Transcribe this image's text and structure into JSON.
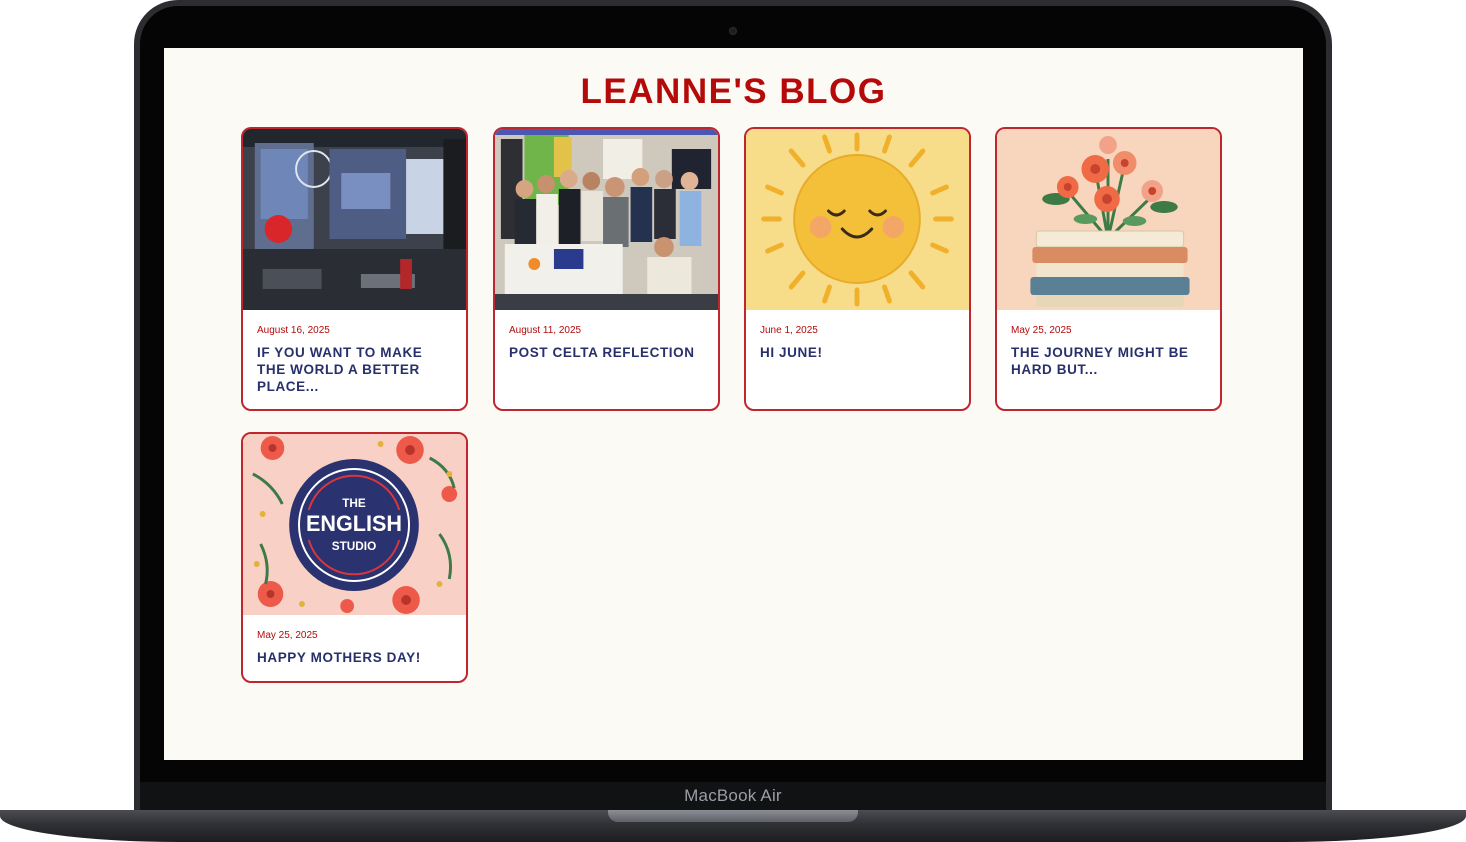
{
  "device": {
    "label": "MacBook Air"
  },
  "blog": {
    "title": "LEANNE'S BLOG",
    "posts": [
      {
        "date": "August 16, 2025",
        "title": "IF YOU WANT TO MAKE THE WORLD A BETTER PLACE...",
        "image": "shop-window-photo"
      },
      {
        "date": "August 11, 2025",
        "title": "POST CELTA REFLECTION",
        "image": "group-photo"
      },
      {
        "date": "June 1, 2025",
        "title": "HI JUNE!",
        "image": "smiling-sun-illustration"
      },
      {
        "date": "May 25, 2025",
        "title": "THE JOURNEY MIGHT BE HARD BUT...",
        "image": "books-and-flowers-illustration"
      },
      {
        "date": "May 25, 2025",
        "title": "HAPPY MOTHERS DAY!",
        "image": "english-studio-logo"
      }
    ],
    "logo": {
      "line1": "THE",
      "line2": "ENGLISH",
      "line3": "STUDIO"
    }
  },
  "colors": {
    "accent": "#b40a0a",
    "card_border": "#c0262d",
    "title_text": "#27306a",
    "page_bg": "#fcfaf5"
  }
}
